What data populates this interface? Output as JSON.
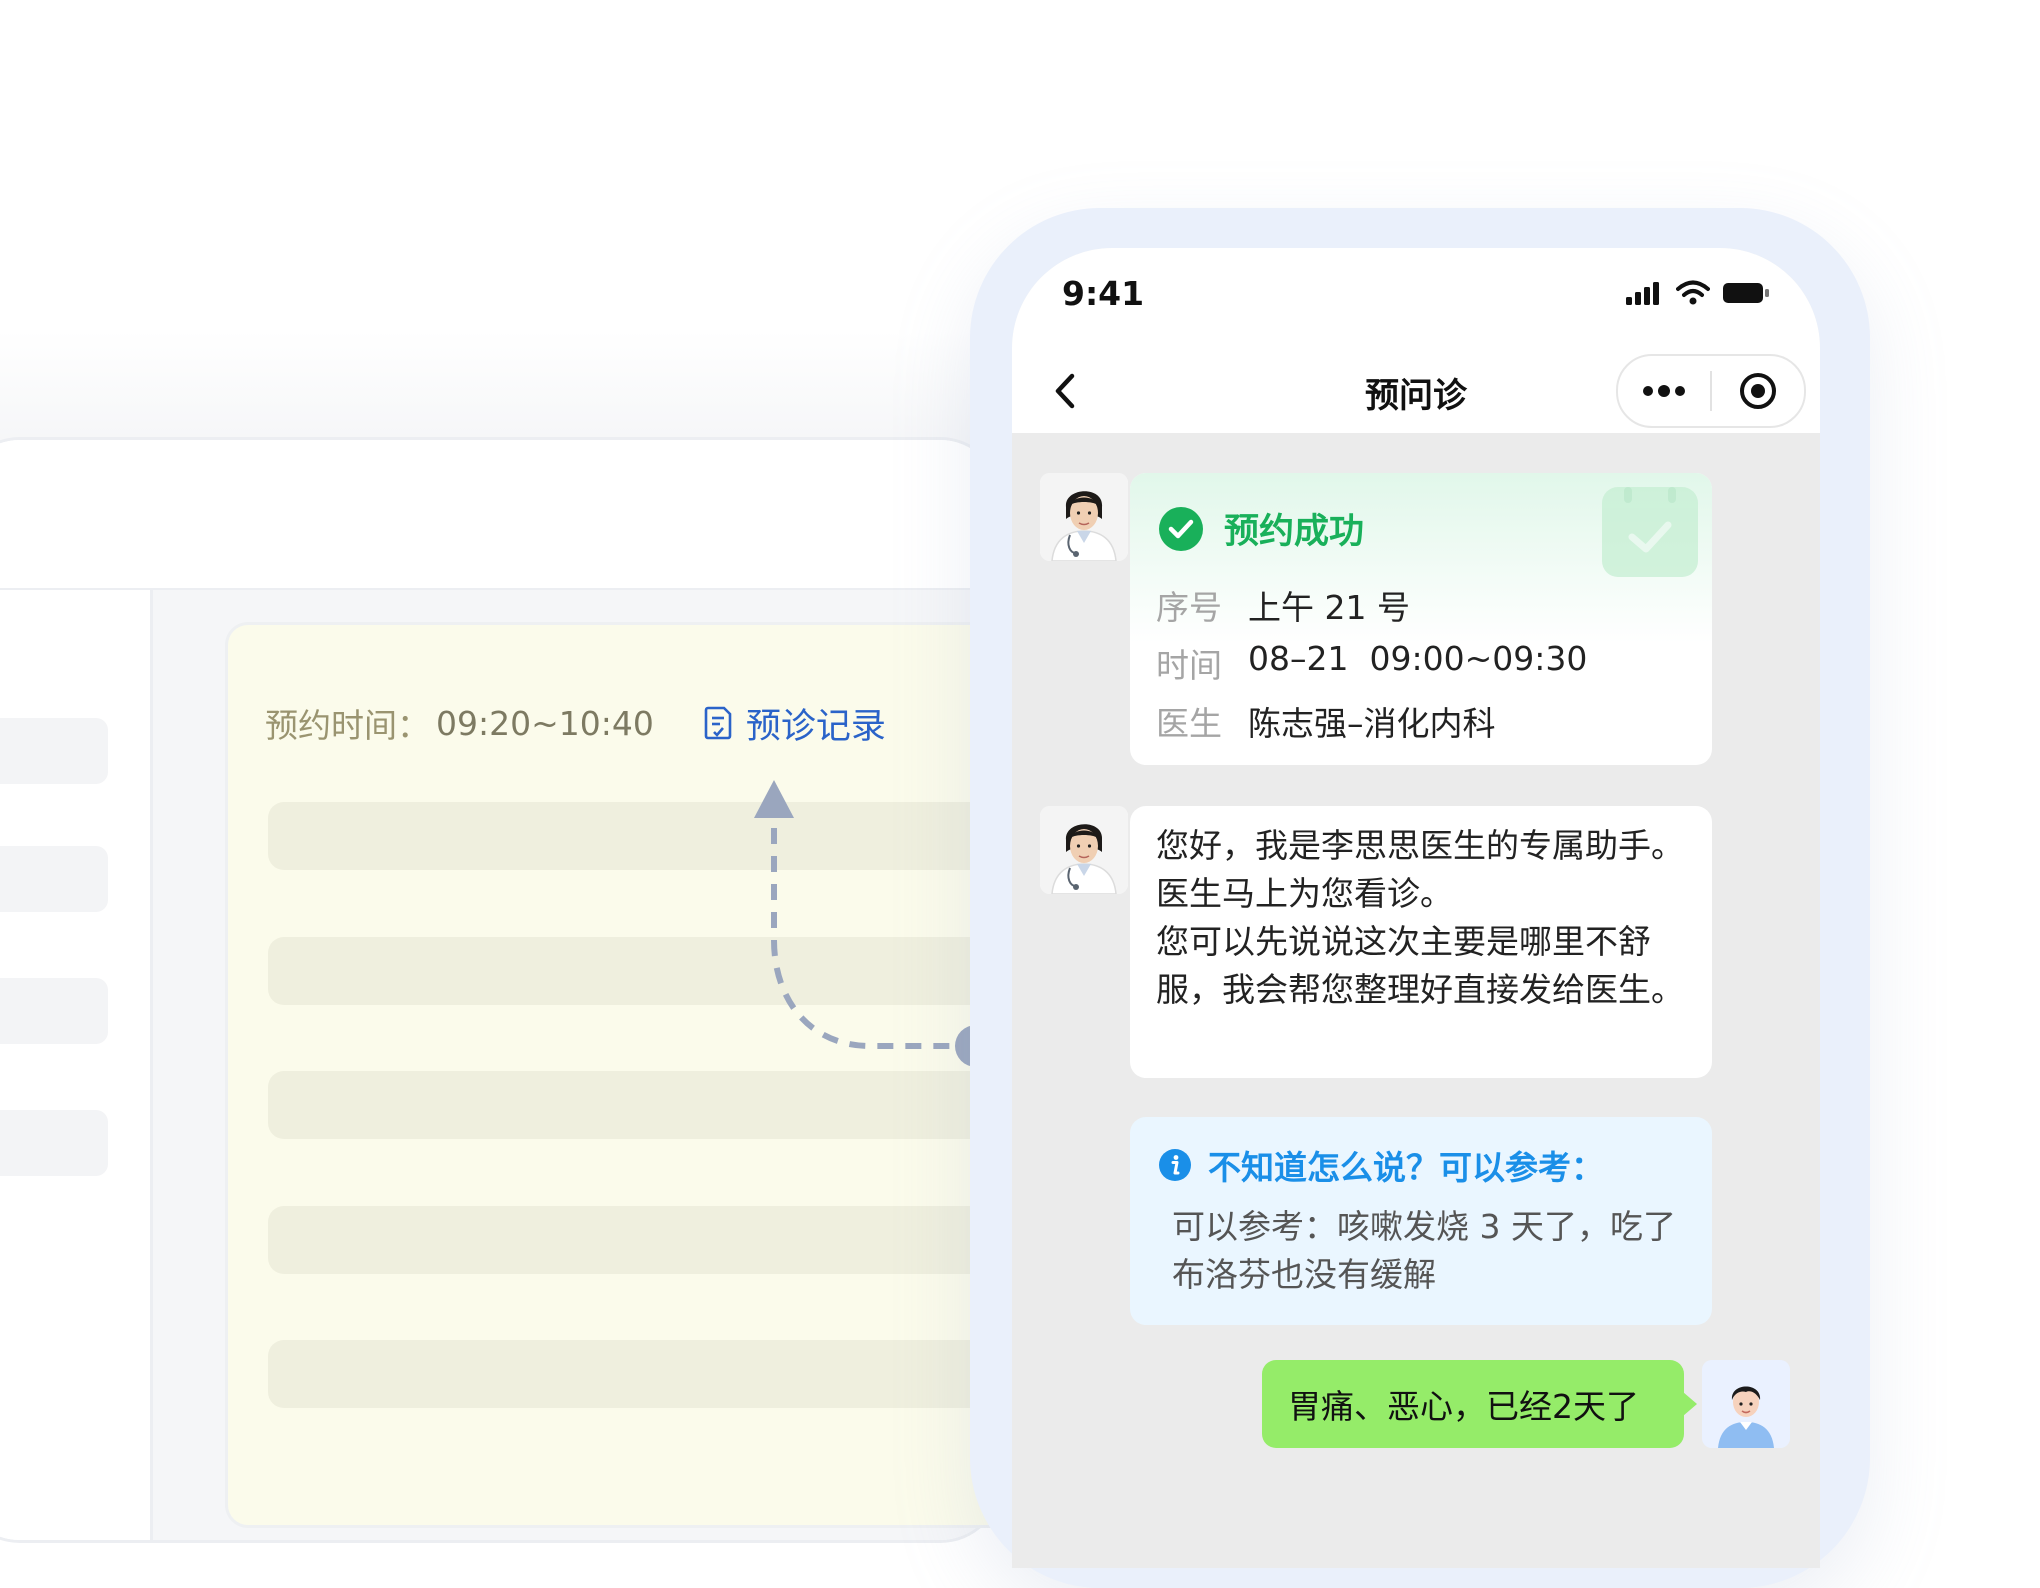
{
  "desktop": {
    "appointment_label": "预约时间：",
    "appointment_time": "09:20~10:40",
    "record_link": "预诊记录"
  },
  "phone": {
    "status_time": "9:41",
    "nav_title": "预问诊",
    "booking": {
      "title": "预约成功",
      "rows": [
        {
          "key": "序号",
          "value": "上午 21 号"
        },
        {
          "key": "时间",
          "value": "08–21  09:00~09:30"
        },
        {
          "key": "医生",
          "value": "陈志强–消化内科"
        }
      ]
    },
    "greeting": {
      "line1": "您好，我是李思思医生的专属助手。医生马上为您看诊。",
      "line2": "您可以先说说这次主要是哪里不舒服，我会帮您整理好直接发给医生。"
    },
    "tip": {
      "title": "不知道怎么说？可以参考：",
      "body": "可以参考：咳嗽发烧 3 天了，吃了布洛芬也没有缓解"
    },
    "user_message": "胃痛、恶心，已经2天了"
  },
  "colors": {
    "success_green": "#19b05a",
    "tip_blue": "#1a8fe8",
    "link_blue": "#2a63c9",
    "chat_bg": "#ebebeb",
    "user_bubble": "#95ec69",
    "note_bg": "#fbfbeb"
  }
}
